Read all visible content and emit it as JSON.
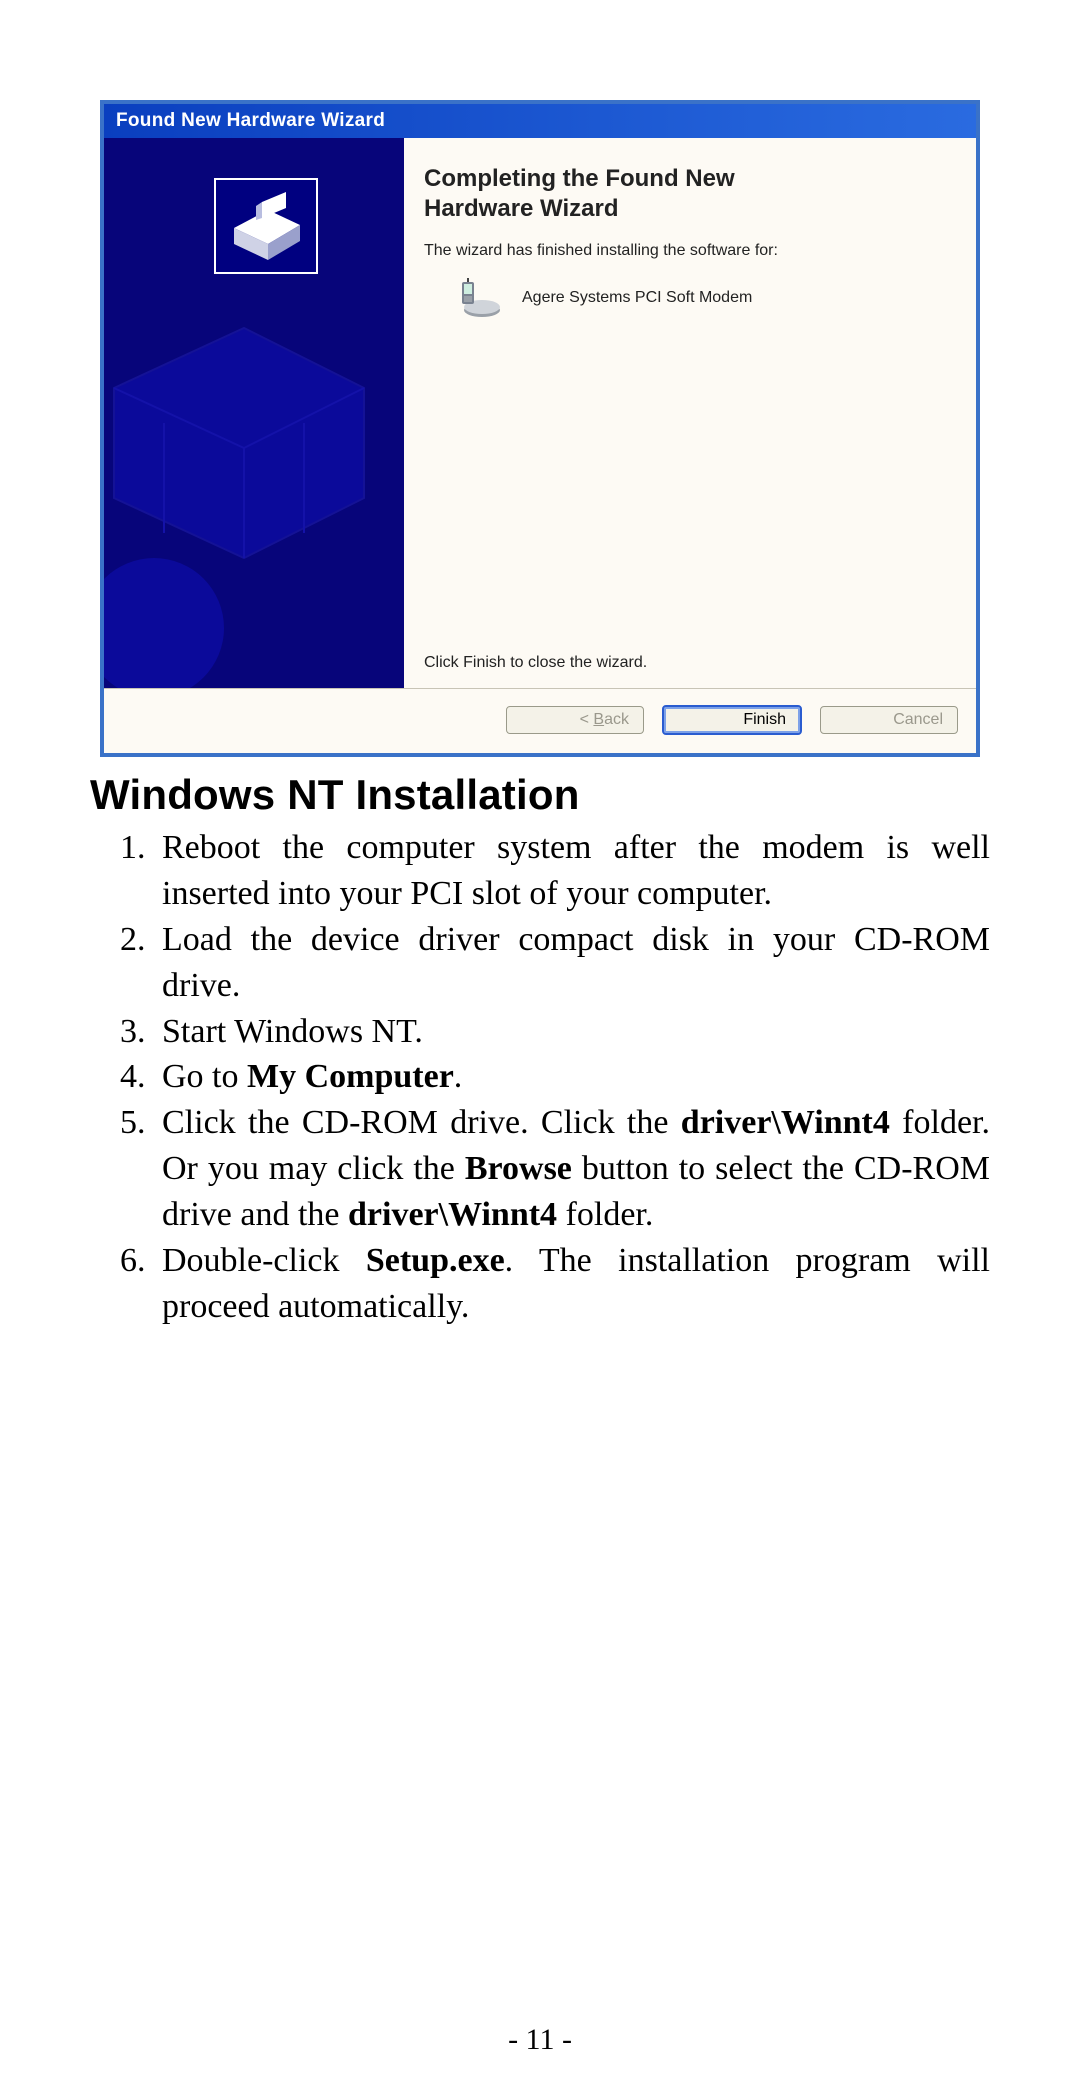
{
  "wizard": {
    "titlebar": "Found New Hardware Wizard",
    "heading_line1": "Completing the Found New",
    "heading_line2": "Hardware Wizard",
    "body_text": "The wizard has finished installing the software for:",
    "device_name": "Agere Systems PCI Soft Modem",
    "finish_text": "Click Finish to close the wizard.",
    "buttons": {
      "back_prefix": "< ",
      "back_mnemonic": "B",
      "back_rest": "ack",
      "finish": "Finish",
      "cancel": "Cancel"
    }
  },
  "section_heading": "Windows NT Installation",
  "steps": [
    {
      "segments": [
        {
          "t": "Reboot the computer system after the modem is well inserted into your PCI slot of your computer.",
          "b": false
        }
      ]
    },
    {
      "segments": [
        {
          "t": "Load the device driver compact disk in your CD-ROM drive.",
          "b": false
        }
      ]
    },
    {
      "segments": [
        {
          "t": "Start Windows NT.",
          "b": false
        }
      ]
    },
    {
      "segments": [
        {
          "t": "Go to ",
          "b": false
        },
        {
          "t": "My Computer",
          "b": true
        },
        {
          "t": ".",
          "b": false
        }
      ]
    },
    {
      "segments": [
        {
          "t": "Click the CD-ROM drive. Click the ",
          "b": false
        },
        {
          "t": "driver\\Winnt4",
          "b": true
        },
        {
          "t": " folder. Or you may click the ",
          "b": false
        },
        {
          "t": "Browse",
          "b": true
        },
        {
          "t": " button to select the CD-ROM drive and the ",
          "b": false
        },
        {
          "t": "driver\\Winnt4",
          "b": true
        },
        {
          "t": " folder.",
          "b": false
        }
      ]
    },
    {
      "segments": [
        {
          "t": "Double-click ",
          "b": false
        },
        {
          "t": "Setup.exe",
          "b": true
        },
        {
          "t": ". The installation program will proceed automatically.",
          "b": false
        }
      ]
    }
  ],
  "page_number": "- 11 -"
}
